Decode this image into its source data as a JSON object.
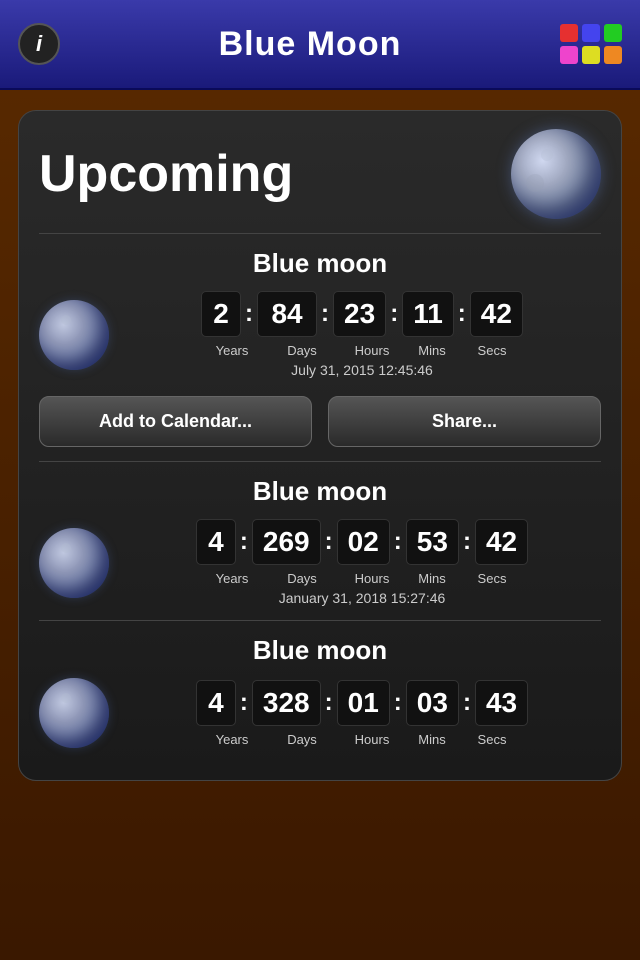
{
  "header": {
    "title": "Blue Moon",
    "info_label": "i",
    "colors": [
      "#e63030",
      "#4444ee",
      "#22cc22",
      "#ee44cc",
      "#dddd22",
      "#ee8822"
    ]
  },
  "upcoming": {
    "title": "Upcoming"
  },
  "events": [
    {
      "title": "Blue moon",
      "countdown": {
        "years": "2",
        "days": "84",
        "hours": "23",
        "mins": "11",
        "secs": "42"
      },
      "labels": {
        "years": "Years",
        "days": "Days",
        "hours": "Hours",
        "mins": "Mins",
        "secs": "Secs"
      },
      "date": "July 31, 2015  12:45:46"
    },
    {
      "title": "Blue moon",
      "countdown": {
        "years": "4",
        "days": "269",
        "hours": "02",
        "mins": "53",
        "secs": "42"
      },
      "labels": {
        "years": "Years",
        "days": "Days",
        "hours": "Hours",
        "mins": "Mins",
        "secs": "Secs"
      },
      "date": "January 31, 2018  15:27:46"
    },
    {
      "title": "Blue moon",
      "countdown": {
        "years": "4",
        "days": "328",
        "hours": "01",
        "mins": "03",
        "secs": "43"
      },
      "labels": {
        "years": "Years",
        "days": "Days",
        "hours": "Hours",
        "mins": "Mins",
        "secs": "Secs"
      },
      "date": ""
    }
  ],
  "buttons": {
    "add_calendar": "Add to Calendar...",
    "share": "Share..."
  }
}
